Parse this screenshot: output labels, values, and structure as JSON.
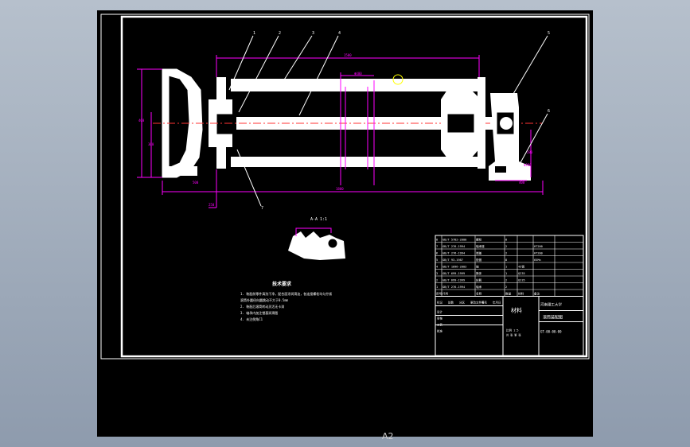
{
  "sheet": {
    "size_label": "A2"
  },
  "colors": {
    "background": "#000000",
    "outline": "#ffffff",
    "dimension": "#ff00ff",
    "leader": "#ffffff",
    "centerline": "#ff3333",
    "highlight": "#ffff00"
  },
  "assembly": {
    "balloons": [
      "1",
      "2",
      "3",
      "4",
      "5",
      "6",
      "7"
    ],
    "dimensions": {
      "overall_length": "1800",
      "inner_length": "1500",
      "diameter": "Φ400",
      "left_height": "400",
      "left_depth": "300",
      "bearing": "250",
      "fit": "Φ280",
      "right_height": "280",
      "bottom_left": "500",
      "bottom_right": "400"
    },
    "section_note": "A-A  1:1"
  },
  "tech_notes": {
    "title": "技术要求",
    "lines": [
      "1. 装配前零件清洗干净，配合面涂润滑油，各连接螺栓均匀拧紧",
      "   滚筒外圆径向圆跳动不大于0.5mm",
      "2. 装配后滚筒转动灵活无卡滞",
      "3. 轴承内加注锂基润滑脂",
      "4. 未注倒角C1"
    ]
  },
  "title_block": {
    "parts_rows": [
      [
        "8",
        "GB/T 5782-2000",
        "螺栓",
        "8",
        "",
        ""
      ],
      [
        "7",
        "GB/T 276-1994",
        "轴承座",
        "2",
        "",
        "HT200"
      ],
      [
        "6",
        "GB/T 276-1994",
        "端盖",
        "2",
        "",
        "HT200"
      ],
      [
        "5",
        "GB/T 93-1987",
        "垫圈",
        "8",
        "",
        "65Mn"
      ],
      [
        "4",
        "GB/T 1096-2003",
        "轴",
        "1",
        "45钢",
        ""
      ],
      [
        "3",
        "GB/T 699-1999",
        "筒体",
        "1",
        "Q235",
        ""
      ],
      [
        "2",
        "GB/T 699-1999",
        "轮毂",
        "2",
        "Q235",
        ""
      ],
      [
        "1",
        "GB/T 276-1994",
        "轴承",
        "2",
        "",
        ""
      ]
    ],
    "header": [
      "序号",
      "代号",
      "名称",
      "数量",
      "材料",
      "备注"
    ],
    "university": "河南理工大学",
    "drawing_title": "滚筒装配图",
    "drawing_number": "GT-00-00-00",
    "material_mark": "材料",
    "rows_left": [
      "标记",
      "处数",
      "分区",
      "更改文件号",
      "签名",
      "年月日"
    ],
    "rows_labels": [
      "设计",
      "审核",
      "工艺",
      "批准"
    ],
    "scale_label": "比例",
    "scale": "1:5",
    "sheet_label": "共 张 第 张"
  }
}
